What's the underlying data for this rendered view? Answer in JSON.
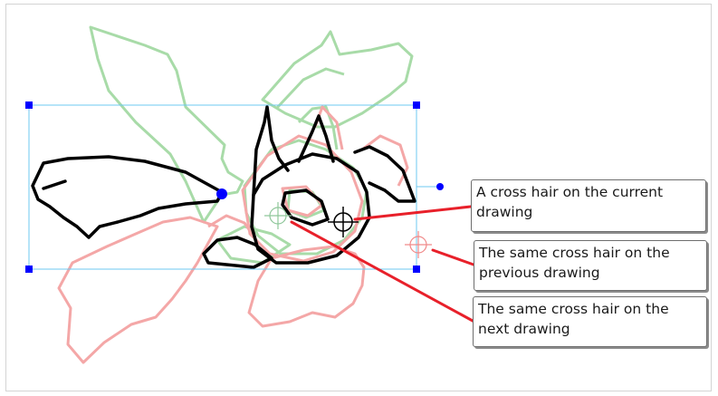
{
  "callouts": {
    "current": "A cross hair on the current drawing",
    "previous": "The same cross hair on the previous drawing",
    "next": "The same cross hair on the next drawing"
  },
  "colors": {
    "current_drawing": "#000000",
    "previous_onion_skin": "#f4a7a7",
    "next_onion_skin": "#a8dba8",
    "bounding_box": "#6ec9f0",
    "handle": "#0000ff",
    "leader_line": "#e8202a"
  },
  "icons": [
    "crosshair-icon",
    "pivot-handle",
    "rotation-handle"
  ]
}
